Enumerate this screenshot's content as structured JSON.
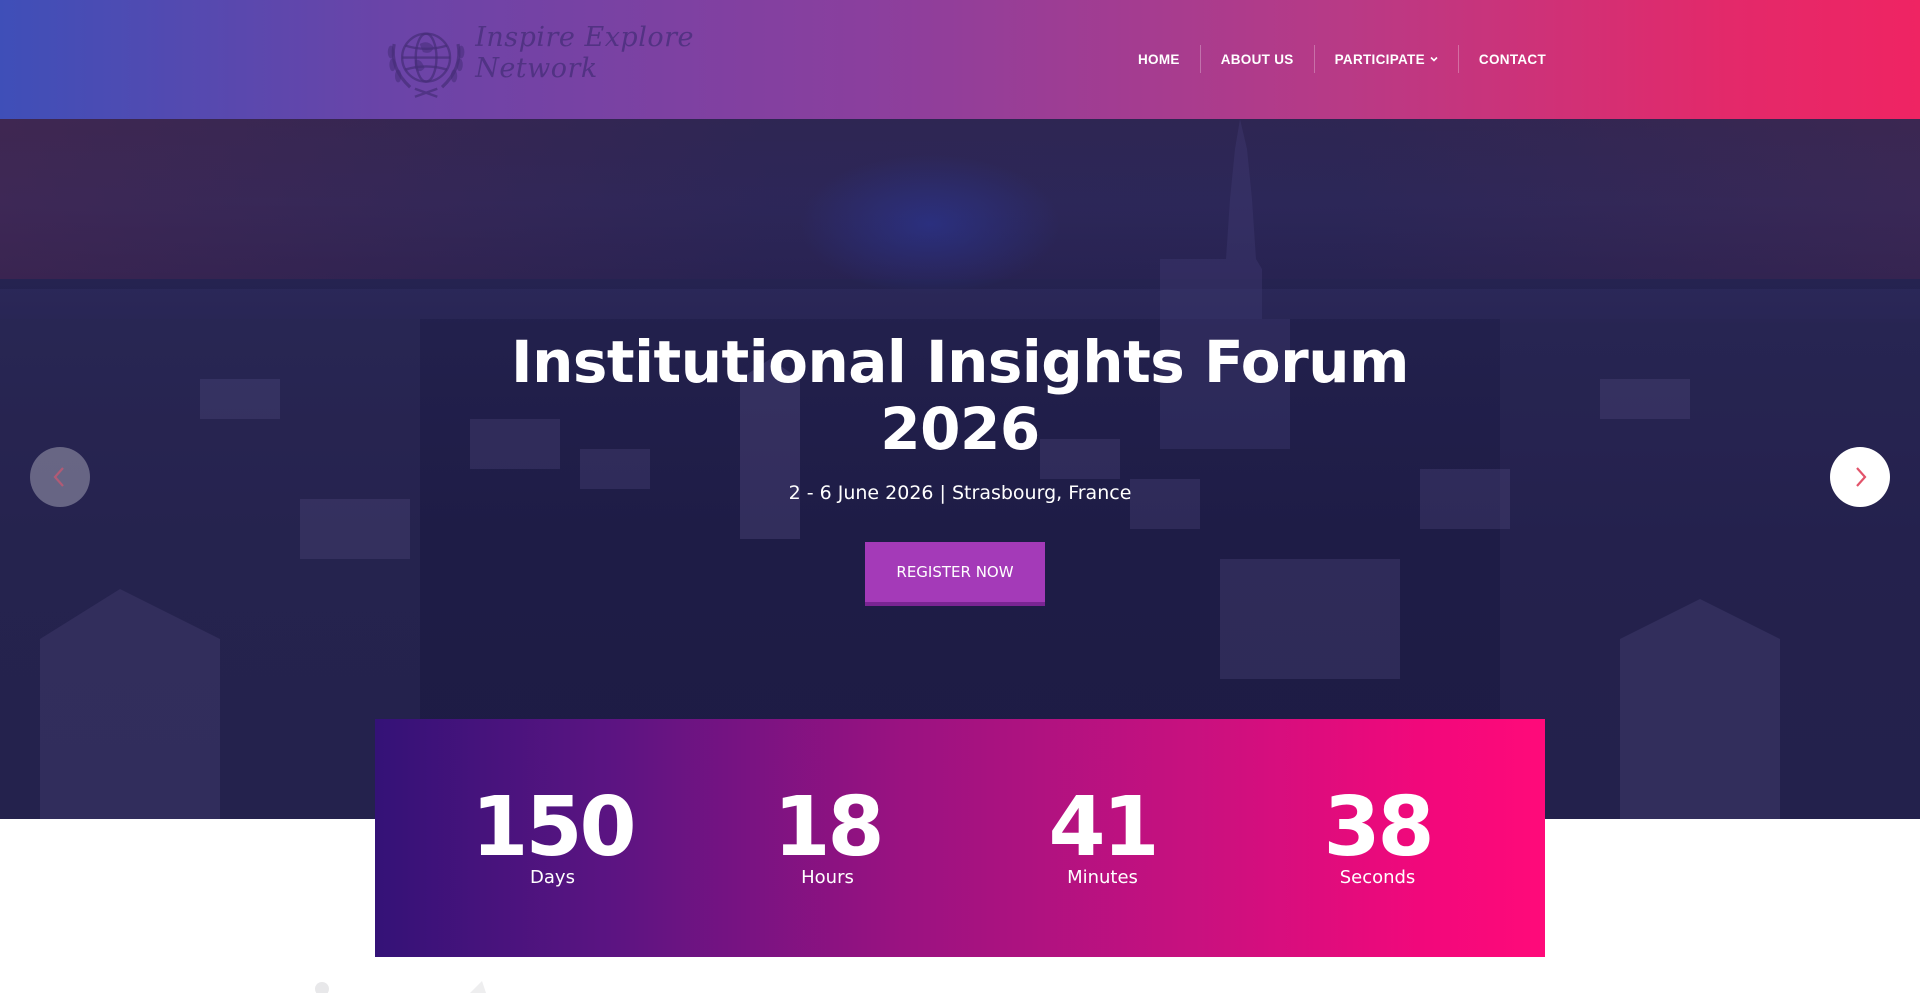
{
  "header": {
    "logo_text": "Inspire Explore Network",
    "nav": [
      {
        "label": "HOME"
      },
      {
        "label": "ABOUT US"
      },
      {
        "label": "PARTICIPATE",
        "has_dropdown": true
      },
      {
        "label": "CONTACT"
      }
    ]
  },
  "hero": {
    "title": "Institutional Insights Forum 2026",
    "subtitle": "2 - 6 June 2026 | Strasbourg, France",
    "cta_label": "REGISTER NOW",
    "prev_icon": "chevron-left-icon",
    "next_icon": "chevron-right-icon"
  },
  "countdown": {
    "items": [
      {
        "value": "150",
        "label": "Days"
      },
      {
        "value": "18",
        "label": "Hours"
      },
      {
        "value": "41",
        "label": "Minutes"
      },
      {
        "value": "38",
        "label": "Seconds"
      }
    ]
  },
  "colors": {
    "header_gradient_start": "#3f4fb8",
    "header_gradient_end": "#ef2463",
    "cta_background": "#a43ab8",
    "countdown_gradient_start": "#341277",
    "countdown_gradient_end": "#ff0a7a",
    "arrow_accent": "#e2536a"
  }
}
